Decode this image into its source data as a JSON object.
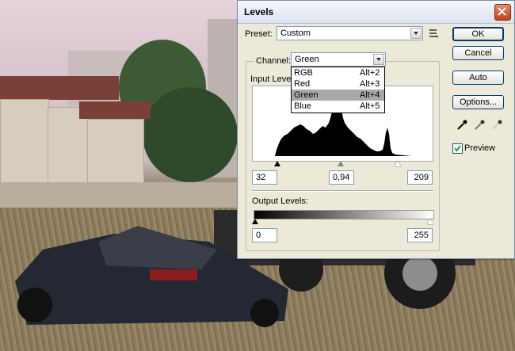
{
  "window": {
    "title": "Levels"
  },
  "preset": {
    "label": "Preset:",
    "value": "Custom"
  },
  "channel": {
    "label": "Channel:",
    "value": "Green",
    "options": [
      {
        "name": "RGB",
        "shortcut": "Alt+2"
      },
      {
        "name": "Red",
        "shortcut": "Alt+3"
      },
      {
        "name": "Green",
        "shortcut": "Alt+4"
      },
      {
        "name": "Blue",
        "shortcut": "Alt+5"
      }
    ]
  },
  "input_levels": {
    "label": "Input Levels:",
    "black": "32",
    "gamma": "0,94",
    "white": "209"
  },
  "output_levels": {
    "label": "Output Levels:",
    "black": "0",
    "white": "255"
  },
  "buttons": {
    "ok": "OK",
    "cancel": "Cancel",
    "auto": "Auto",
    "options": "Options..."
  },
  "preview": {
    "label": "Preview",
    "checked": true
  },
  "icons": {
    "close": "close-icon",
    "preset_menu": "preset-options-icon",
    "eyedroppers": [
      "black-point-eyedropper-icon",
      "gray-point-eyedropper-icon",
      "white-point-eyedropper-icon"
    ]
  },
  "colors": {
    "title_bar": "#dbe3f0",
    "dialog_bg": "#ece9d8",
    "close_button": "#c3401d",
    "selected_item": "#a8a8a8"
  }
}
